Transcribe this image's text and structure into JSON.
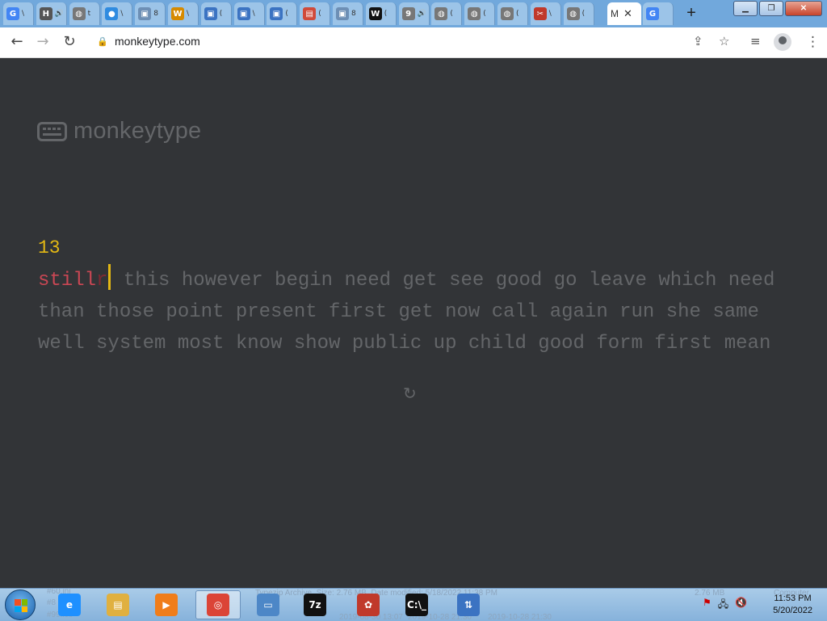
{
  "browser": {
    "tabs": [
      {
        "icon": "G",
        "color": "#4285f4",
        "mini": "\\"
      },
      {
        "icon": "H",
        "color": "#555",
        "mini": "🔊"
      },
      {
        "icon": "◍",
        "color": "#777",
        "mini": "t"
      },
      {
        "icon": "●",
        "color": "#2f8be0",
        "mini": "\\"
      },
      {
        "icon": "▣",
        "color": "#6d8fb5",
        "mini": "8"
      },
      {
        "icon": "W",
        "color": "#d68a00",
        "mini": "\\"
      },
      {
        "icon": "▣",
        "color": "#3b73c2",
        "mini": "("
      },
      {
        "icon": "▣",
        "color": "#3b73c2",
        "mini": "\\"
      },
      {
        "icon": "▣",
        "color": "#3b73c2",
        "mini": "("
      },
      {
        "icon": "▤",
        "color": "#d04a3a",
        "mini": "("
      },
      {
        "icon": "▣",
        "color": "#6d8fb5",
        "mini": "8"
      },
      {
        "icon": "W",
        "color": "#111",
        "mini": "("
      },
      {
        "icon": "9",
        "color": "#777",
        "mini": "🔊"
      },
      {
        "icon": "◍",
        "color": "#777",
        "mini": "("
      },
      {
        "icon": "◍",
        "color": "#777",
        "mini": "("
      },
      {
        "icon": "◍",
        "color": "#777",
        "mini": "("
      },
      {
        "icon": "✂",
        "color": "#c0392b",
        "mini": "\\"
      },
      {
        "icon": "◍",
        "color": "#777",
        "mini": "("
      }
    ],
    "active_tab": {
      "label": "M",
      "close": "✕"
    },
    "last_tab_icon": "G",
    "new_tab": "+",
    "window_buttons": {
      "minimize": "▁",
      "restore": "❐",
      "close": "✕"
    },
    "url": "monkeytype.com",
    "nav": {
      "back": "←",
      "forward": "→",
      "reload": "↻"
    },
    "toolbar_icons": {
      "share": "⇪",
      "star": "☆",
      "media": "≡"
    },
    "menu": "⋮"
  },
  "page": {
    "logo_text": "monkeytype",
    "word_count": "13",
    "typed_word": "still",
    "extra_char": "r",
    "line1_rest": "this however begin need get see good go leave which need",
    "line2": "than those point present first get now call again run she same",
    "line3": "well system most know show public up child good form first mean",
    "restart_icon": "↻"
  },
  "taskbar": {
    "background_text": [
      "#60.ini",
      "#8",
      "#99.ico",
      "Typezip Archive, Size: 2.76 MB, Date modified: 5/18/2022 11:38 PM",
      "2.76 MB",
      "Computer",
      "2019-08-30 13:07",
      "2019-10-28 21:30",
      "2019-10-28 21:30"
    ],
    "items": [
      {
        "name": "internet-explorer",
        "label": "e",
        "color": "#1e90ff"
      },
      {
        "name": "file-explorer",
        "label": "▤",
        "color": "#e0b040"
      },
      {
        "name": "media-player",
        "label": "▶",
        "color": "#f07d1a"
      },
      {
        "name": "chrome",
        "label": "◎",
        "color": "#db4437"
      },
      {
        "name": "photo-viewer",
        "label": "▭",
        "color": "#4d87c7"
      },
      {
        "name": "7zip",
        "label": "7z",
        "color": "#111"
      },
      {
        "name": "settings-app",
        "label": "✿",
        "color": "#c0392b"
      },
      {
        "name": "command-prompt",
        "label": "C:\\_",
        "color": "#111"
      },
      {
        "name": "network-app",
        "label": "⇅",
        "color": "#3b73c2"
      }
    ],
    "time": "11:53 PM",
    "date": "5/20/2022"
  }
}
